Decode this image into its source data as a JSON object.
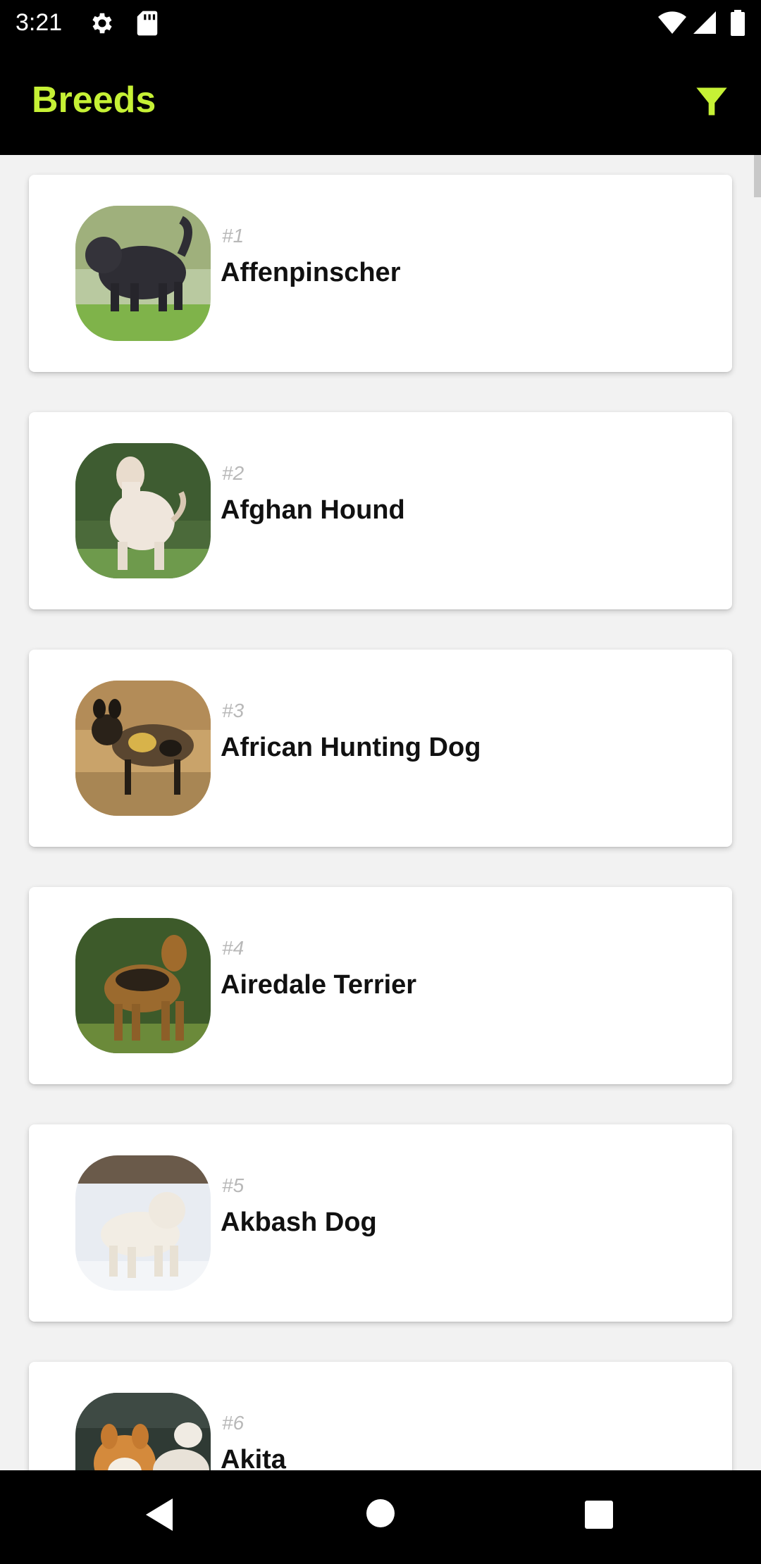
{
  "status_bar": {
    "time": "3:21",
    "icons": [
      "settings-icon",
      "sd-card-icon",
      "wifi-icon",
      "signal-icon",
      "battery-icon"
    ]
  },
  "app_bar": {
    "title": "Breeds",
    "accent_color": "#c6f135",
    "filter_icon": "filter-icon"
  },
  "breeds": [
    {
      "rank": "#1",
      "name": "Affenpinscher"
    },
    {
      "rank": "#2",
      "name": "Afghan Hound"
    },
    {
      "rank": "#3",
      "name": "African Hunting Dog"
    },
    {
      "rank": "#4",
      "name": "Airedale Terrier"
    },
    {
      "rank": "#5",
      "name": "Akbash Dog"
    },
    {
      "rank": "#6",
      "name": "Akita"
    }
  ],
  "nav_bar": {
    "icons": [
      "back-icon",
      "home-icon",
      "recents-icon"
    ]
  }
}
